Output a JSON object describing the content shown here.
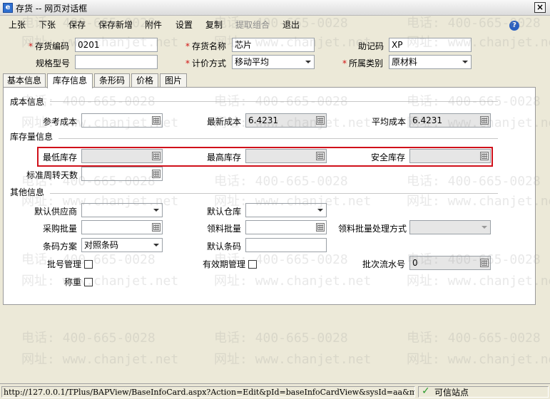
{
  "window": {
    "app_icon": "e",
    "title": "存货 -- 网页对话框",
    "close": "×"
  },
  "menu": {
    "items": [
      "上张",
      "下张",
      "保存",
      "保存新增",
      "附件",
      "设置",
      "复制",
      "提取组合",
      "退出"
    ],
    "help": "?"
  },
  "header": {
    "required_mark": "*",
    "code_label": "存货编码",
    "code_value": "0201",
    "name_label": "存货名称",
    "name_value": "芯片",
    "mnemonic_label": "助记码",
    "mnemonic_value": "XP",
    "spec_label": "规格型号",
    "spec_value": "",
    "pricing_label": "计价方式",
    "pricing_value": "移动平均",
    "category_label": "所属类别",
    "category_value": "原材料"
  },
  "tabs": [
    "基本信息",
    "库存信息",
    "条形码",
    "价格",
    "图片"
  ],
  "active_tab": "库存信息",
  "cost": {
    "section": "成本信息",
    "ref_label": "参考成本",
    "ref_value": "",
    "latest_label": "最新成本",
    "latest_value": "6.4231",
    "avg_label": "平均成本",
    "avg_value": "6.4231"
  },
  "stock": {
    "section": "库存量信息",
    "min_label": "最低库存",
    "min_value": "",
    "max_label": "最高库存",
    "max_value": "",
    "safe_label": "安全库存",
    "safe_value": "",
    "turnover_label": "标准周转天数",
    "turnover_value": ""
  },
  "other": {
    "section": "其他信息",
    "supplier_label": "默认供应商",
    "supplier_value": "",
    "warehouse_label": "默认仓库",
    "warehouse_value": "",
    "purchase_batch_label": "采购批量",
    "purchase_batch_value": "",
    "issue_batch_label": "领料批量",
    "issue_batch_value": "",
    "issue_method_label": "领料批量处理方式",
    "issue_method_value": "",
    "barcode_scheme_label": "条码方案",
    "barcode_scheme_value": "对照条码",
    "default_barcode_label": "默认条码",
    "default_barcode_value": "",
    "batch_mgmt_label": "批号管理",
    "expiry_mgmt_label": "有效期管理",
    "batch_serial_label": "批次流水号",
    "batch_serial_value": "0",
    "weighing_label": "称重"
  },
  "watermark": {
    "phone": "电话: 400-665-0028",
    "site": "网址: www.chanjet.net"
  },
  "status": {
    "url": "http://127.0.0.1/TPlus/BAPView/BaseInfoCard.aspx?Action=Edit&pId=baseInfoCardView&sysId=aa&mId=aa",
    "zone_icon": "✓",
    "zone": "可信站点"
  },
  "colors": {
    "highlight": "#d0101a",
    "required": "#d01010"
  }
}
